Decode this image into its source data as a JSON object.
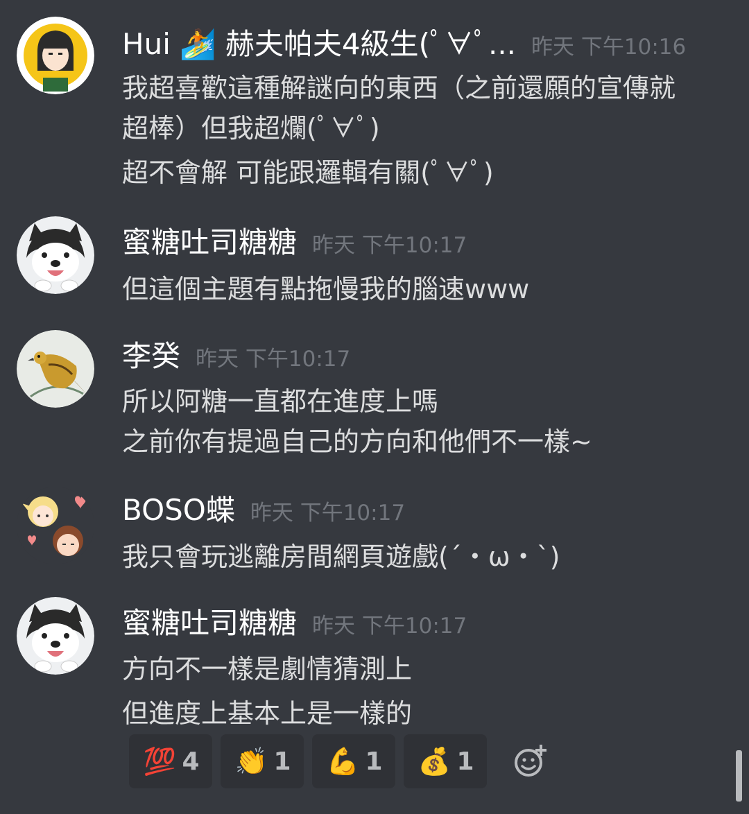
{
  "messages": [
    {
      "username": "Hui 🏄 赫夫帕夫4級生(ﾟ∀ﾟ...",
      "timestamp": "昨天 下午10:16",
      "lines": [
        "我超喜歡這種解謎向的東西（之前還願的宣傳就",
        "超棒）但我超爛(ﾟ∀ﾟ)",
        "超不會解 可能跟邏輯有關(ﾟ∀ﾟ)"
      ]
    },
    {
      "username": "蜜糖吐司糖糖",
      "timestamp": "昨天 下午10:17",
      "lines": [
        "但這個主題有點拖慢我的腦速www"
      ]
    },
    {
      "username": "李癸",
      "timestamp": "昨天 下午10:17",
      "lines": [
        "所以阿糖一直都在進度上嗎",
        "之前你有提過自己的方向和他們不一樣~"
      ]
    },
    {
      "username": "BOSO蝶",
      "timestamp": "昨天 下午10:17",
      "lines": [
        "我只會玩逃離房間網頁遊戲(´・ω・`)"
      ]
    },
    {
      "username": "蜜糖吐司糖糖",
      "timestamp": "昨天 下午10:17",
      "lines": [
        "方向不一樣是劇情猜測上",
        "但進度上基本上是一樣的"
      ]
    }
  ],
  "reactions": [
    {
      "emoji": "💯",
      "count": "4",
      "icon": "hundred-points-icon"
    },
    {
      "emoji": "👏",
      "count": "1",
      "icon": "clapping-hands-icon"
    },
    {
      "emoji": "💪",
      "count": "1",
      "icon": "flexed-biceps-icon"
    },
    {
      "emoji": "💰",
      "count": "1",
      "icon": "money-bag-icon"
    }
  ],
  "colors": {
    "background": "#36393f",
    "username": "#ffffff",
    "timestamp": "#72767d",
    "text": "#dcddde",
    "reaction_bg": "#2f3136"
  }
}
